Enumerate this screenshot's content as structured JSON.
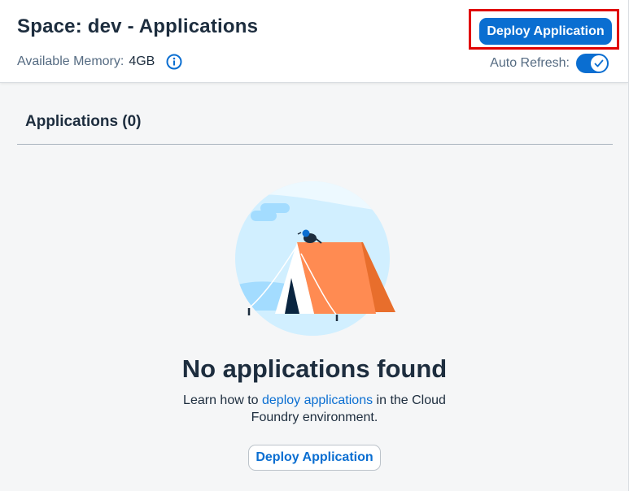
{
  "header": {
    "title": "Space: dev - Applications",
    "memory_label": "Available Memory:",
    "memory_value": "4GB",
    "info_icon": "info-icon",
    "deploy_button_label": "Deploy Application",
    "auto_refresh_label": "Auto Refresh:",
    "auto_refresh_on": true
  },
  "section": {
    "title": "Applications (0)"
  },
  "empty_state": {
    "illustration": "tent-illustration",
    "title": "No applications found",
    "desc_before": "Learn how to ",
    "desc_link": "deploy applications",
    "desc_after": " in the Cloud Foundry environment.",
    "button_label": "Deploy Application"
  },
  "colors": {
    "accent": "#0a6ed1",
    "highlight": "#e00000",
    "tent_orange": "#ff7f4f",
    "text_dark": "#1d2d3e"
  }
}
